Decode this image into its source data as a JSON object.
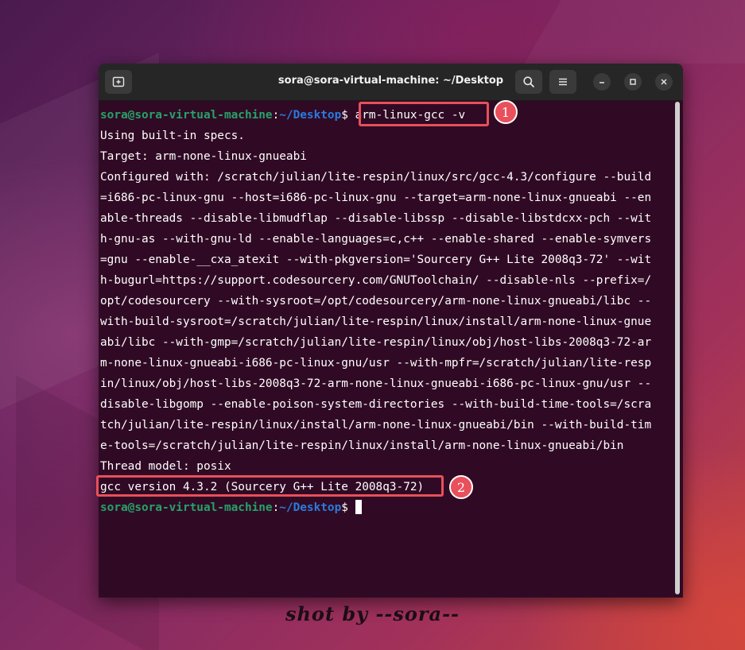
{
  "window": {
    "title": "sora@sora-virtual-machine: ~/Desktop"
  },
  "icons": {
    "new_tab": "new-tab-icon",
    "search": "search-icon",
    "menu": "hamburger-menu-icon",
    "minimize": "minimize-icon",
    "maximize": "maximize-icon",
    "close": "close-icon"
  },
  "colors": {
    "terminal_bg": "#300a24",
    "prompt_user": "#26a269",
    "prompt_path": "#2a7bde",
    "highlight": "#e8505b"
  },
  "prompt": {
    "user_host": "sora@sora-virtual-machine",
    "colon": ":",
    "path": "~/Desktop",
    "dollar": "$ "
  },
  "terminal": {
    "command": "arm-linux-gcc -v",
    "output": [
      "Using built-in specs.",
      "Target: arm-none-linux-gnueabi",
      "Configured with: /scratch/julian/lite-respin/linux/src/gcc-4.3/configure --build",
      "=i686-pc-linux-gnu --host=i686-pc-linux-gnu --target=arm-none-linux-gnueabi --en",
      "able-threads --disable-libmudflap --disable-libssp --disable-libstdcxx-pch --wit",
      "h-gnu-as --with-gnu-ld --enable-languages=c,c++ --enable-shared --enable-symvers",
      "=gnu --enable-__cxa_atexit --with-pkgversion='Sourcery G++ Lite 2008q3-72' --wit",
      "h-bugurl=https://support.codesourcery.com/GNUToolchain/ --disable-nls --prefix=/",
      "opt/codesourcery --with-sysroot=/opt/codesourcery/arm-none-linux-gnueabi/libc --",
      "with-build-sysroot=/scratch/julian/lite-respin/linux/install/arm-none-linux-gnue",
      "abi/libc --with-gmp=/scratch/julian/lite-respin/linux/obj/host-libs-2008q3-72-ar",
      "m-none-linux-gnueabi-i686-pc-linux-gnu/usr --with-mpfr=/scratch/julian/lite-resp",
      "in/linux/obj/host-libs-2008q3-72-arm-none-linux-gnueabi-i686-pc-linux-gnu/usr --",
      "disable-libgomp --enable-poison-system-directories --with-build-time-tools=/scra",
      "tch/julian/lite-respin/linux/install/arm-none-linux-gnueabi/bin --with-build-tim",
      "e-tools=/scratch/julian/lite-respin/linux/install/arm-none-linux-gnueabi/bin",
      "Thread model: posix",
      "gcc version 4.3.2 (Sourcery G++ Lite 2008q3-72)"
    ]
  },
  "annotations": {
    "badge1": "1",
    "badge2": "2"
  },
  "signature": "shot by --sora--"
}
